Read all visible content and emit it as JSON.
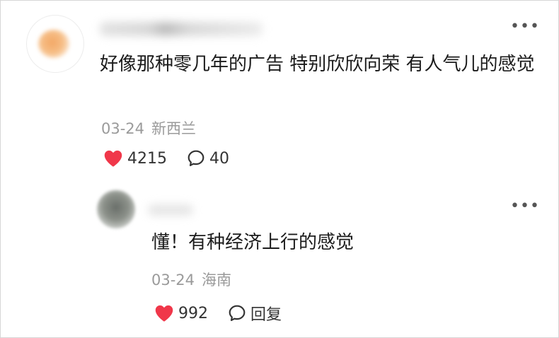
{
  "comment": {
    "text": "好像那种零几年的广告 特别欣欣向荣 有人气儿的感觉",
    "date": "03-24",
    "location": "新西兰",
    "likes": "4215",
    "replies": "40"
  },
  "reply": {
    "text": "懂！有种经济上行的感觉",
    "date": "03-24",
    "location": "海南",
    "likes": "992",
    "reply_label": "回复"
  },
  "icons": {
    "like": "heart-icon",
    "comment": "comment-bubble-icon",
    "more": "more-dots-icon"
  },
  "colors": {
    "like": "#f0374a",
    "meta": "#9a9a9a",
    "text": "#1b1b1b"
  }
}
